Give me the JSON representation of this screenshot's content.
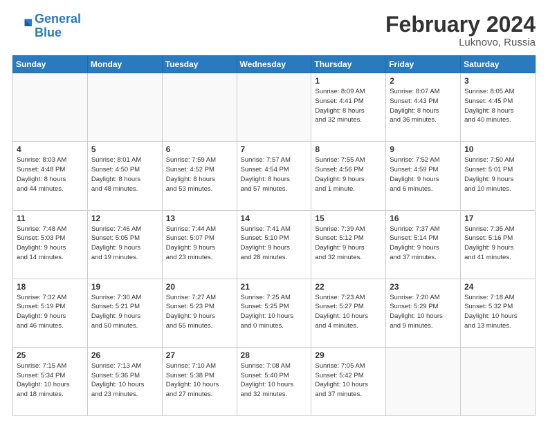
{
  "logo": {
    "line1": "General",
    "line2": "Blue"
  },
  "title": "February 2024",
  "location": "Luknovo, Russia",
  "days_header": [
    "Sunday",
    "Monday",
    "Tuesday",
    "Wednesday",
    "Thursday",
    "Friday",
    "Saturday"
  ],
  "weeks": [
    [
      {
        "day": "",
        "info": ""
      },
      {
        "day": "",
        "info": ""
      },
      {
        "day": "",
        "info": ""
      },
      {
        "day": "",
        "info": ""
      },
      {
        "day": "1",
        "info": "Sunrise: 8:09 AM\nSunset: 4:41 PM\nDaylight: 8 hours\nand 32 minutes."
      },
      {
        "day": "2",
        "info": "Sunrise: 8:07 AM\nSunset: 4:43 PM\nDaylight: 8 hours\nand 36 minutes."
      },
      {
        "day": "3",
        "info": "Sunrise: 8:05 AM\nSunset: 4:45 PM\nDaylight: 8 hours\nand 40 minutes."
      }
    ],
    [
      {
        "day": "4",
        "info": "Sunrise: 8:03 AM\nSunset: 4:48 PM\nDaylight: 8 hours\nand 44 minutes."
      },
      {
        "day": "5",
        "info": "Sunrise: 8:01 AM\nSunset: 4:50 PM\nDaylight: 8 hours\nand 48 minutes."
      },
      {
        "day": "6",
        "info": "Sunrise: 7:59 AM\nSunset: 4:52 PM\nDaylight: 8 hours\nand 53 minutes."
      },
      {
        "day": "7",
        "info": "Sunrise: 7:57 AM\nSunset: 4:54 PM\nDaylight: 8 hours\nand 57 minutes."
      },
      {
        "day": "8",
        "info": "Sunrise: 7:55 AM\nSunset: 4:56 PM\nDaylight: 9 hours\nand 1 minute."
      },
      {
        "day": "9",
        "info": "Sunrise: 7:52 AM\nSunset: 4:59 PM\nDaylight: 9 hours\nand 6 minutes."
      },
      {
        "day": "10",
        "info": "Sunrise: 7:50 AM\nSunset: 5:01 PM\nDaylight: 9 hours\nand 10 minutes."
      }
    ],
    [
      {
        "day": "11",
        "info": "Sunrise: 7:48 AM\nSunset: 5:03 PM\nDaylight: 9 hours\nand 14 minutes."
      },
      {
        "day": "12",
        "info": "Sunrise: 7:46 AM\nSunset: 5:05 PM\nDaylight: 9 hours\nand 19 minutes."
      },
      {
        "day": "13",
        "info": "Sunrise: 7:44 AM\nSunset: 5:07 PM\nDaylight: 9 hours\nand 23 minutes."
      },
      {
        "day": "14",
        "info": "Sunrise: 7:41 AM\nSunset: 5:10 PM\nDaylight: 9 hours\nand 28 minutes."
      },
      {
        "day": "15",
        "info": "Sunrise: 7:39 AM\nSunset: 5:12 PM\nDaylight: 9 hours\nand 32 minutes."
      },
      {
        "day": "16",
        "info": "Sunrise: 7:37 AM\nSunset: 5:14 PM\nDaylight: 9 hours\nand 37 minutes."
      },
      {
        "day": "17",
        "info": "Sunrise: 7:35 AM\nSunset: 5:16 PM\nDaylight: 9 hours\nand 41 minutes."
      }
    ],
    [
      {
        "day": "18",
        "info": "Sunrise: 7:32 AM\nSunset: 5:19 PM\nDaylight: 9 hours\nand 46 minutes."
      },
      {
        "day": "19",
        "info": "Sunrise: 7:30 AM\nSunset: 5:21 PM\nDaylight: 9 hours\nand 50 minutes."
      },
      {
        "day": "20",
        "info": "Sunrise: 7:27 AM\nSunset: 5:23 PM\nDaylight: 9 hours\nand 55 minutes."
      },
      {
        "day": "21",
        "info": "Sunrise: 7:25 AM\nSunset: 5:25 PM\nDaylight: 10 hours\nand 0 minutes."
      },
      {
        "day": "22",
        "info": "Sunrise: 7:23 AM\nSunset: 5:27 PM\nDaylight: 10 hours\nand 4 minutes."
      },
      {
        "day": "23",
        "info": "Sunrise: 7:20 AM\nSunset: 5:29 PM\nDaylight: 10 hours\nand 9 minutes."
      },
      {
        "day": "24",
        "info": "Sunrise: 7:18 AM\nSunset: 5:32 PM\nDaylight: 10 hours\nand 13 minutes."
      }
    ],
    [
      {
        "day": "25",
        "info": "Sunrise: 7:15 AM\nSunset: 5:34 PM\nDaylight: 10 hours\nand 18 minutes."
      },
      {
        "day": "26",
        "info": "Sunrise: 7:13 AM\nSunset: 5:36 PM\nDaylight: 10 hours\nand 23 minutes."
      },
      {
        "day": "27",
        "info": "Sunrise: 7:10 AM\nSunset: 5:38 PM\nDaylight: 10 hours\nand 27 minutes."
      },
      {
        "day": "28",
        "info": "Sunrise: 7:08 AM\nSunset: 5:40 PM\nDaylight: 10 hours\nand 32 minutes."
      },
      {
        "day": "29",
        "info": "Sunrise: 7:05 AM\nSunset: 5:42 PM\nDaylight: 10 hours\nand 37 minutes."
      },
      {
        "day": "",
        "info": ""
      },
      {
        "day": "",
        "info": ""
      }
    ]
  ]
}
